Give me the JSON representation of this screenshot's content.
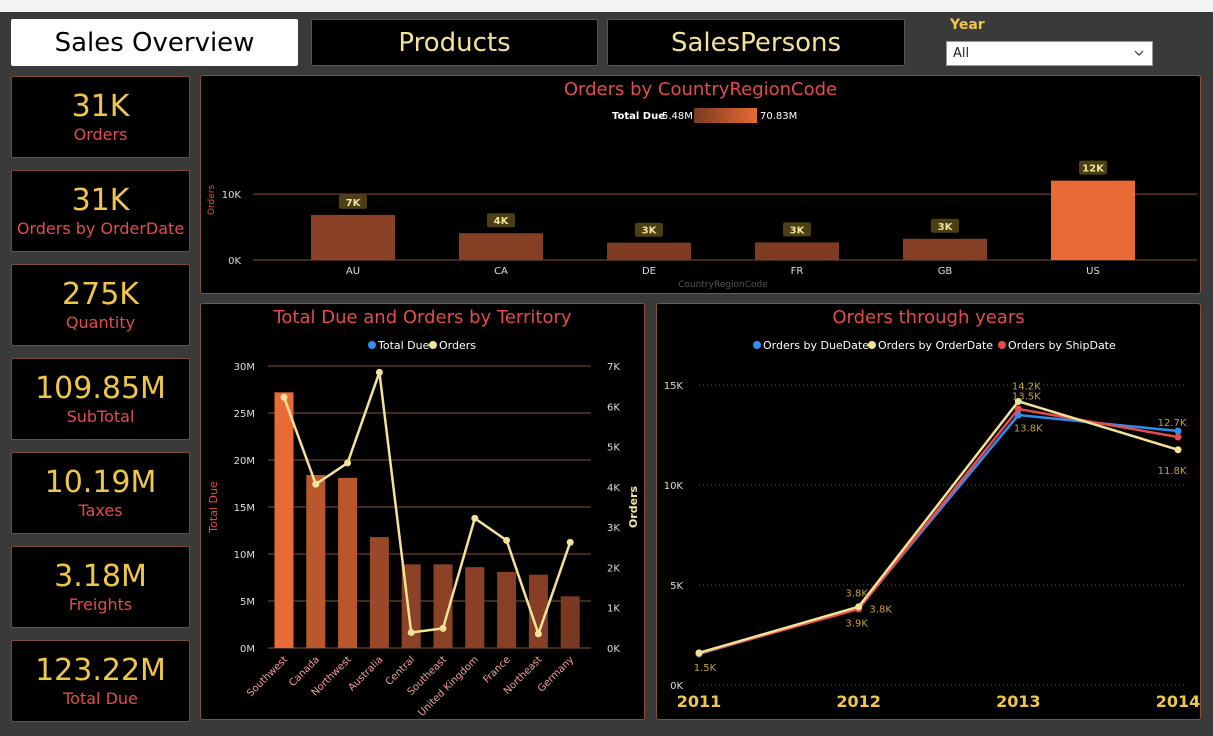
{
  "tabs": [
    {
      "label": "Sales Overview",
      "active": true
    },
    {
      "label": "Products",
      "active": false
    },
    {
      "label": "SalesPersons",
      "active": false
    }
  ],
  "filter": {
    "label": "Year",
    "value": "All"
  },
  "kpis": [
    {
      "value": "31K",
      "label": "Orders"
    },
    {
      "value": "31K",
      "label": "Orders by OrderDate"
    },
    {
      "value": "275K",
      "label": "Quantity"
    },
    {
      "value": "109.85M",
      "label": "SubTotal"
    },
    {
      "value": "10.19M",
      "label": "Taxes"
    },
    {
      "value": "3.18M",
      "label": "Freights"
    },
    {
      "value": "123.22M",
      "label": "Total Due"
    }
  ],
  "colors": {
    "accent_title": "#e44c4c",
    "kpi_value": "#f0c64a",
    "bar_dark": "#7a3a22",
    "bar_bright": "#e86a34",
    "line_due": "#2f8df5",
    "line_order": "#f2e29a",
    "line_ship": "#e44c4c"
  },
  "chart_data": [
    {
      "type": "bar",
      "title": "Orders by CountryRegionCode",
      "legend": {
        "label": "Total Due",
        "min_label": "5.48M",
        "max_label": "70.83M"
      },
      "xlabel": "CountryRegionCode",
      "ylabel": "Orders",
      "categories": [
        "AU",
        "CA",
        "DE",
        "FR",
        "GB",
        "US"
      ],
      "values": [
        6843,
        4067,
        2623,
        2672,
        3219,
        12041
      ],
      "data_labels": [
        "7K",
        "4K",
        "3K",
        "3K",
        "3K",
        "12K"
      ],
      "color_weights": [
        0.15,
        0.1,
        0.05,
        0.05,
        0.08,
        1.0
      ],
      "yticks": [
        {
          "v": 0,
          "label": "0K"
        },
        {
          "v": 10000,
          "label": "10K"
        }
      ],
      "ylim": [
        0,
        13500
      ]
    },
    {
      "type": "bar",
      "title": "Total Due and Orders by Territory",
      "legend": [
        "Total Due",
        "Orders"
      ],
      "ylabel": "Total Due",
      "y2label": "Orders",
      "categories": [
        "Southwest",
        "Canada",
        "Northwest",
        "Australia",
        "Central",
        "Southeast",
        "United Kingdom",
        "France",
        "Northeast",
        "Germany"
      ],
      "series": [
        {
          "name": "Total Due",
          "values": [
            27.2,
            18.4,
            18.1,
            11.8,
            8.9,
            8.9,
            8.6,
            8.1,
            7.8,
            5.5
          ]
        },
        {
          "name": "Orders",
          "values": [
            6224,
            4067,
            4594,
            6843,
            385,
            486,
            3219,
            2672,
            352,
            2623
          ]
        }
      ],
      "yticks": [
        "0M",
        "5M",
        "10M",
        "15M",
        "20M",
        "25M",
        "30M"
      ],
      "y2ticks": [
        "0K",
        "1K",
        "2K",
        "3K",
        "4K",
        "5K",
        "6K",
        "7K"
      ],
      "ylim": [
        0,
        30
      ],
      "y2lim": [
        0,
        7000
      ]
    },
    {
      "type": "line",
      "title": "Orders through years",
      "legend": [
        "Orders by DueDate",
        "Orders by OrderDate",
        "Orders by ShipDate"
      ],
      "x": [
        "2011",
        "2012",
        "2013",
        "2014"
      ],
      "series": [
        {
          "name": "Orders by DueDate",
          "values": [
            1550,
            3850,
            13500,
            12700
          ]
        },
        {
          "name": "Orders by OrderDate",
          "values": [
            1607,
            3915,
            14182,
            11761
          ]
        },
        {
          "name": "Orders by ShipDate",
          "values": [
            1580,
            3800,
            13800,
            12400
          ]
        }
      ],
      "point_labels": [
        {
          "text": "1.5K",
          "series": 1,
          "i": 0,
          "dx": 6,
          "dy": 18
        },
        {
          "text": "3.8K",
          "series": 1,
          "i": 1,
          "dx": -2,
          "dy": -10
        },
        {
          "text": "3.8K",
          "series": 1,
          "i": 1,
          "dx": 22,
          "dy": 6
        },
        {
          "text": "3.9K",
          "series": 1,
          "i": 1,
          "dx": -2,
          "dy": 20
        },
        {
          "text": "14.2K",
          "series": 1,
          "i": 2,
          "dx": 8,
          "dy": -12
        },
        {
          "text": "13.5K",
          "series": 1,
          "i": 2,
          "dx": 8,
          "dy": -2
        },
        {
          "text": "13.8K",
          "series": 1,
          "i": 2,
          "dx": 10,
          "dy": 30
        },
        {
          "text": "12.7K",
          "series": 1,
          "i": 3,
          "dx": -6,
          "dy": -24
        },
        {
          "text": "11.8K",
          "series": 1,
          "i": 3,
          "dx": -6,
          "dy": 24
        }
      ],
      "yticks": [
        {
          "v": 0,
          "label": "0K"
        },
        {
          "v": 5000,
          "label": "5K"
        },
        {
          "v": 10000,
          "label": "10K"
        },
        {
          "v": 15000,
          "label": "15K"
        }
      ],
      "ylim": [
        0,
        15000
      ]
    }
  ]
}
